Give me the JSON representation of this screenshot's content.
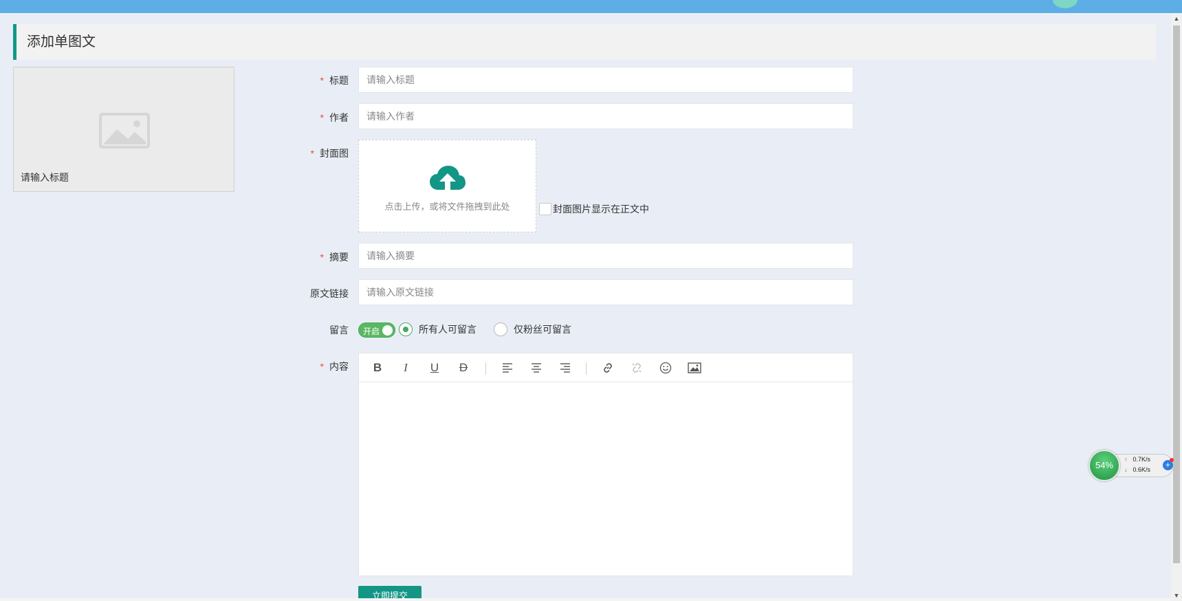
{
  "header": {
    "title": "添加单图文"
  },
  "preview": {
    "title": "请输入标题"
  },
  "form": {
    "title": {
      "label": "标题",
      "placeholder": "请输入标题"
    },
    "author": {
      "label": "作者",
      "placeholder": "请输入作者"
    },
    "cover": {
      "label": "封面图",
      "upload_hint": "点击上传，或将文件拖拽到此处",
      "show_in_body_label": "封面图片显示在正文中"
    },
    "summary": {
      "label": "摘要",
      "placeholder": "请输入摘要"
    },
    "source_link": {
      "label": "原文链接",
      "placeholder": "请输入原文链接"
    },
    "comment": {
      "label": "留言",
      "switch_text": "开启",
      "options": [
        {
          "label": "所有人可留言",
          "selected": true
        },
        {
          "label": "仅粉丝可留言",
          "selected": false
        }
      ]
    },
    "content": {
      "label": "内容"
    },
    "required_mark": "*",
    "submit_label": "立即提交"
  },
  "toolbar": {
    "bold": "B",
    "italic": "I",
    "underline": "U",
    "strike": "D"
  },
  "net_monitor": {
    "percent": "54%",
    "up": "0.7K/s",
    "down": "0.6K/s"
  },
  "colors": {
    "accent": "#119887",
    "topbar": "#5dade6",
    "required": "#e6483e",
    "switch_on": "#5bb862"
  }
}
